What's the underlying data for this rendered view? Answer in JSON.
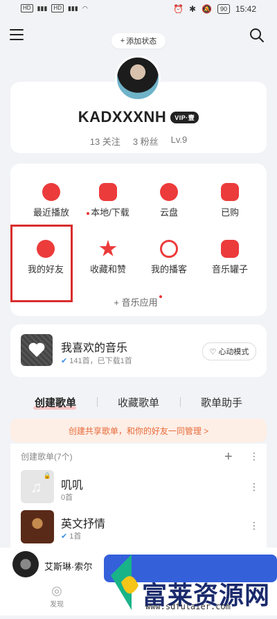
{
  "status_bar": {
    "time": "15:42",
    "battery": "90",
    "net_left": "HD",
    "net_right": "HD"
  },
  "header": {
    "add_status": "添加状态"
  },
  "profile": {
    "username": "KADXXXNH",
    "vip": "VIP·壹",
    "following": "13 关注",
    "fans": "3 粉丝",
    "level": "Lv.9"
  },
  "grid": [
    {
      "label": "最近播放"
    },
    {
      "label": "本地/下载"
    },
    {
      "label": "云盘"
    },
    {
      "label": "已购"
    },
    {
      "label": "我的好友"
    },
    {
      "label": "收藏和赞"
    },
    {
      "label": "我的播客"
    },
    {
      "label": "音乐罐子"
    }
  ],
  "music_apps": "音乐应用",
  "liked": {
    "title": "我喜欢的音乐",
    "subtitle": "141首，已下载1首",
    "mode": "心动模式"
  },
  "tabs": [
    "创建歌单",
    "收藏歌单",
    "歌单助手"
  ],
  "banner": "创建共享歌单，和你的好友一同管理 >",
  "created": {
    "header": "创建歌单(7个)",
    "playlists": [
      {
        "title": "叽叽",
        "count": "0首"
      },
      {
        "title": "英文抒情",
        "count": "1首"
      }
    ]
  },
  "player": {
    "song": "艾斯琳·索尔"
  },
  "bottom_tabs": {
    "discover": "发现"
  },
  "watermark": {
    "text": "富莱资源网",
    "url": "www.sdfulaier.com"
  },
  "colors": {
    "accent": "#ec3b3b",
    "highlight": "#d92d2d",
    "banner_text": "#e76b3a"
  }
}
